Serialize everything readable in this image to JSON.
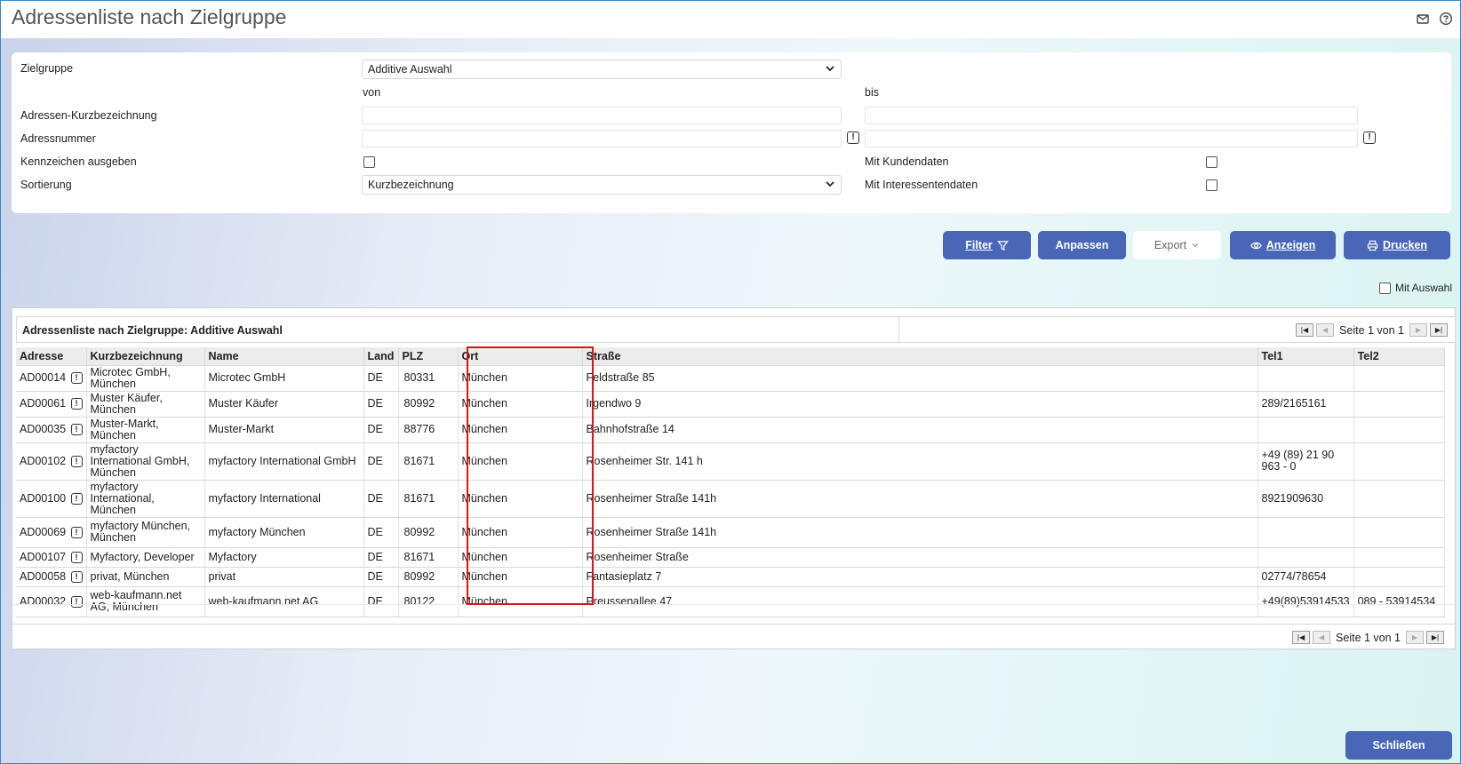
{
  "window": {
    "title": "Adressenliste nach Zielgruppe"
  },
  "form": {
    "zielgruppe_label": "Zielgruppe",
    "zielgruppe_value": "Additive Auswahl",
    "von_label": "von",
    "bis_label": "bis",
    "kurzbez_label": "Adressen-Kurzbezeichnung",
    "adressnummer_label": "Adressnummer",
    "kennzeichen_label": "Kennzeichen ausgeben",
    "sortierung_label": "Sortierung",
    "sortierung_value": "Kurzbezeichnung",
    "kundendaten_label": "Mit Kundendaten",
    "interessentendaten_label": "Mit Interessentendaten",
    "info_glyph": "!"
  },
  "toolbar": {
    "filter": "Filter",
    "anpassen": "Anpassen",
    "export": "Export",
    "anzeigen": "Anzeigen",
    "drucken": "Drucken",
    "mit_auswahl": "Mit Auswahl"
  },
  "grid": {
    "title": "Adressenliste nach Zielgruppe: Additive Auswahl",
    "pager_text": "Seite 1 von 1",
    "columns": [
      "Adresse",
      "Kurzbezeichnung",
      "Name",
      "Land",
      "PLZ",
      "Ort",
      "Straße",
      "Tel1",
      "Tel2"
    ],
    "rows": [
      {
        "adresse": "AD00014",
        "kurz": "Microtec GmbH, München",
        "name": "Microtec GmbH",
        "land": "DE",
        "plz": "80331",
        "ort": "München",
        "strasse": "Feldstraße 85",
        "tel1": "",
        "tel2": ""
      },
      {
        "adresse": "AD00061",
        "kurz": "Muster Käufer, München",
        "name": "Muster Käufer",
        "land": "DE",
        "plz": "80992",
        "ort": "München",
        "strasse": "Irgendwo 9",
        "tel1": "289/2165161",
        "tel2": ""
      },
      {
        "adresse": "AD00035",
        "kurz": "Muster-Markt, München",
        "name": "Muster-Markt",
        "land": "DE",
        "plz": "88776",
        "ort": "München",
        "strasse": "Bahnhofstraße 14",
        "tel1": "",
        "tel2": ""
      },
      {
        "adresse": "AD00102",
        "kurz": "myfactory International GmbH, München",
        "name": "myfactory International GmbH",
        "land": "DE",
        "plz": "81671",
        "ort": "München",
        "strasse": "Rosenheimer Str. 141 h",
        "tel1": "+49 (89) 21 90 963 - 0",
        "tel2": ""
      },
      {
        "adresse": "AD00100",
        "kurz": "myfactory International, München",
        "name": "myfactory International",
        "land": "DE",
        "plz": "81671",
        "ort": "München",
        "strasse": "Rosenheimer Straße 141h",
        "tel1": "8921909630",
        "tel2": ""
      },
      {
        "adresse": "AD00069",
        "kurz": "myfactory München, München",
        "name": "myfactory München",
        "land": "DE",
        "plz": "80992",
        "ort": "München",
        "strasse": "Rosenheimer Straße 141h",
        "tel1": "",
        "tel2": ""
      },
      {
        "adresse": "AD00107",
        "kurz": "Myfactory, Developer",
        "name": "Myfactory",
        "land": "DE",
        "plz": "81671",
        "ort": "München",
        "strasse": "Rosenheimer Straße",
        "tel1": "",
        "tel2": ""
      },
      {
        "adresse": "AD00058",
        "kurz": "privat, München",
        "name": "privat",
        "land": "DE",
        "plz": "80992",
        "ort": "München",
        "strasse": "Fantasieplatz 7",
        "tel1": "02774/78654",
        "tel2": ""
      },
      {
        "adresse": "AD00032",
        "kurz": "web-kaufmann.net AG, München",
        "name": "web-kaufmann.net AG",
        "land": "DE",
        "plz": "80122",
        "ort": "München",
        "strasse": "Preussenallee 47",
        "tel1": "+49(89)53914533",
        "tel2": "089 - 53914534"
      }
    ]
  },
  "footer": {
    "close": "Schließen"
  },
  "colors": {
    "primary_button": "#4a66b7",
    "highlight_border": "#d9141b",
    "window_border": "#3a86c8"
  }
}
